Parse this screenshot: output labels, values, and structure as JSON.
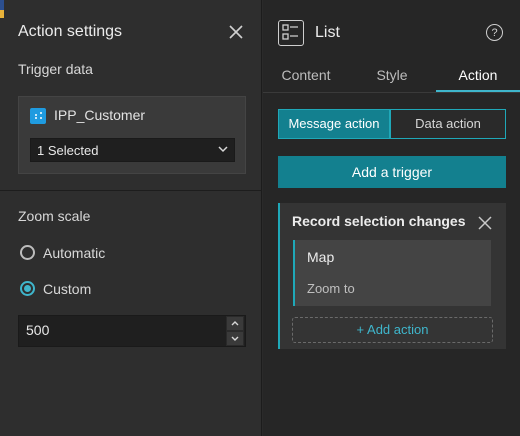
{
  "colors": {
    "accent": "#13808f",
    "accent_border": "#1fa8b8",
    "datasource_icon": "#1f9be0"
  },
  "left_panel": {
    "title": "Action settings",
    "trigger_data_label": "Trigger data",
    "data_source": {
      "name": "IPP_Customer",
      "icon": "feature-layer-icon"
    },
    "selection_select": {
      "value": "1 Selected"
    },
    "zoom_scale_label": "Zoom scale",
    "radios": [
      {
        "label": "Automatic",
        "checked": false
      },
      {
        "label": "Custom",
        "checked": true
      }
    ],
    "zoom_input": {
      "value": "500"
    }
  },
  "right_panel": {
    "widget_title": "List",
    "widget_icon": "list-widget-icon",
    "help_icon_glyph": "?",
    "tabs": [
      {
        "label": "Content",
        "active": false
      },
      {
        "label": "Style",
        "active": false
      },
      {
        "label": "Action",
        "active": true
      }
    ],
    "segments": [
      {
        "label": "Message action",
        "active": true
      },
      {
        "label": "Data action",
        "active": false
      }
    ],
    "add_trigger_label": "Add a trigger",
    "trigger_card": {
      "title": "Record selection changes",
      "action": {
        "target": "Map",
        "action_name": "Zoom to"
      },
      "add_action_label": "+ Add action"
    }
  }
}
